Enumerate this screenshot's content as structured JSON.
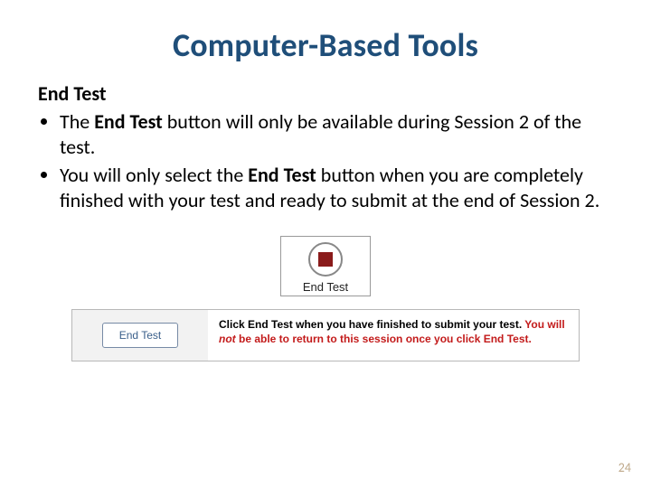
{
  "title": "Computer-Based Tools",
  "section_heading": "End Test",
  "bullets": {
    "b1_pre": "The ",
    "b1_bold": "End Test",
    "b1_post": " button will only be available during Session 2 of the test.",
    "b2_pre": "You will only select the ",
    "b2_bold": "End Test",
    "b2_post": " button when you are completely finished with your test and ready to submit at the end of Session 2."
  },
  "graphic1_label": "End Test",
  "panel": {
    "button_label": "End Test",
    "text_pre": "Click End Test when you have finished to submit your test. ",
    "warn1": "You will ",
    "warn_em": "not",
    "warn2": " be able to return to this session once you click End Test."
  },
  "page_number": "24"
}
